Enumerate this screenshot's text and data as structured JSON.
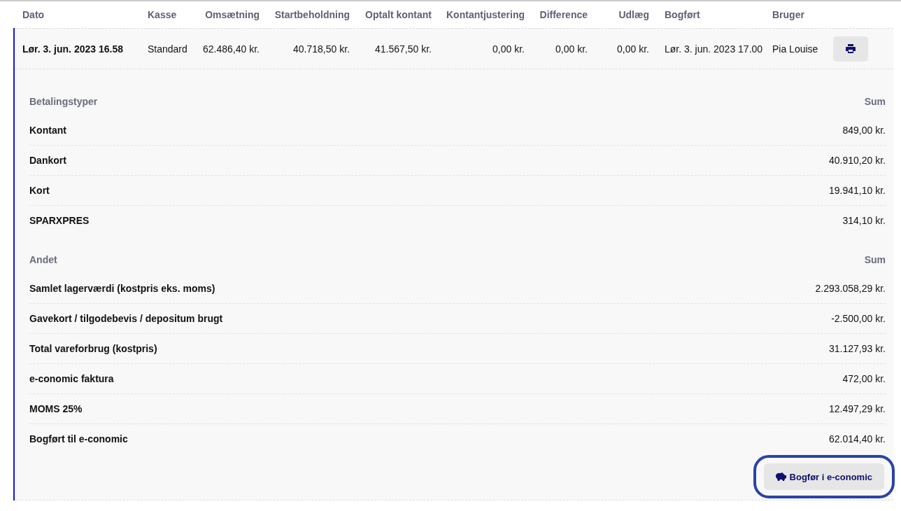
{
  "table": {
    "columns": [
      {
        "label": "Dato"
      },
      {
        "label": "Kasse"
      },
      {
        "label": "Omsætning"
      },
      {
        "label": "Startbeholdning"
      },
      {
        "label": "Optalt kontant"
      },
      {
        "label": "Kontantjustering"
      },
      {
        "label": "Difference"
      },
      {
        "label": "Udlæg"
      },
      {
        "label": "Bogført"
      },
      {
        "label": "Bruger"
      }
    ],
    "rows": [
      {
        "expanded": true,
        "cells": [
          "Lør. 3. jun. 2023 16.58",
          "Standard",
          "62.486,40 kr.",
          "40.718,50 kr.",
          "41.567,50 kr.",
          "0,00 kr.",
          "0,00 kr.",
          "0,00 kr.",
          "Lør. 3. jun. 2023 17.00",
          "Pia Louise"
        ]
      }
    ]
  },
  "details": {
    "groups": [
      {
        "title": "Betalingstyper",
        "sum_label": "Sum",
        "items": [
          {
            "label": "Kontant",
            "amount": "849,00 kr."
          },
          {
            "label": "Dankort",
            "amount": "40.910,20 kr."
          },
          {
            "label": "Kort",
            "amount": "19.941,10 kr."
          },
          {
            "label": "SPARXPRES",
            "amount": "314,10 kr."
          }
        ]
      },
      {
        "title": "Andet",
        "sum_label": "Sum",
        "items": [
          {
            "label": "Samlet lagerværdi (kostpris eks. moms)",
            "amount": "2.293.058,29 kr."
          },
          {
            "label": "Gavekort / tilgodebevis / depositum brugt",
            "amount": "-2.500,00 kr."
          },
          {
            "label": "Total vareforbrug (kostpris)",
            "amount": "31.127,93 kr."
          },
          {
            "label": "e-conomic faktura",
            "amount": "472,00 kr."
          },
          {
            "label": "MOMS 25%",
            "amount": "12.497,29 kr."
          },
          {
            "label": "Bogført til e-conomic",
            "amount": "62.014,40 kr."
          }
        ]
      }
    ],
    "action": {
      "label": "Bogfør i e-conomic",
      "highlighted": true
    }
  }
}
